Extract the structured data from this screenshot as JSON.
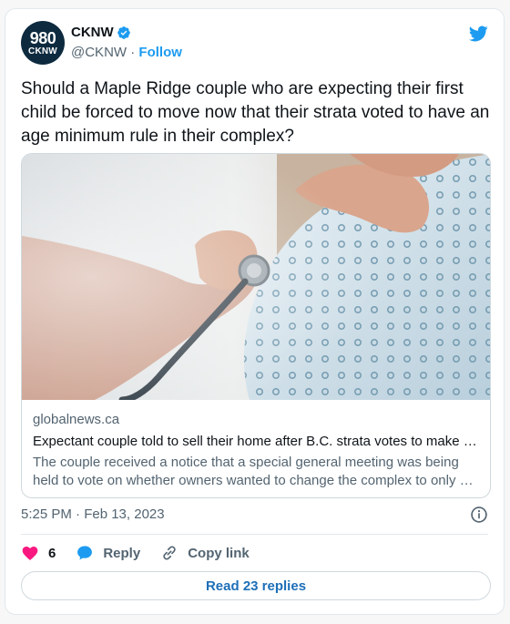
{
  "account": {
    "avatar_line1": "980",
    "avatar_line2": "CKNW",
    "name": "CKNW",
    "handle": "@CKNW",
    "separator": "·",
    "follow_label": "Follow",
    "verified": true
  },
  "tweet": {
    "text": "Should a Maple Ridge couple who are expecting their first child be forced to move now that their strata voted to have an age minimum rule in their complex?"
  },
  "link_card": {
    "domain": "globalnews.ca",
    "title": "Expectant couple told to sell their home after B.C. strata votes to make …",
    "description": "The couple received a notice that a special general meeting was being held to vote on whether owners wanted to change the complex to only …",
    "image_icon": "pregnant-woman-stethoscope-photo"
  },
  "timestamp": "5:25 PM · Feb 13, 2023",
  "actions": {
    "like_count": "6",
    "reply_label": "Reply",
    "copy_link_label": "Copy link"
  },
  "read_replies_label": "Read 23 replies",
  "colors": {
    "brand_blue": "#1d9bf0",
    "like_pink": "#f91880",
    "text_primary": "#0f1419",
    "text_secondary": "#536471"
  }
}
